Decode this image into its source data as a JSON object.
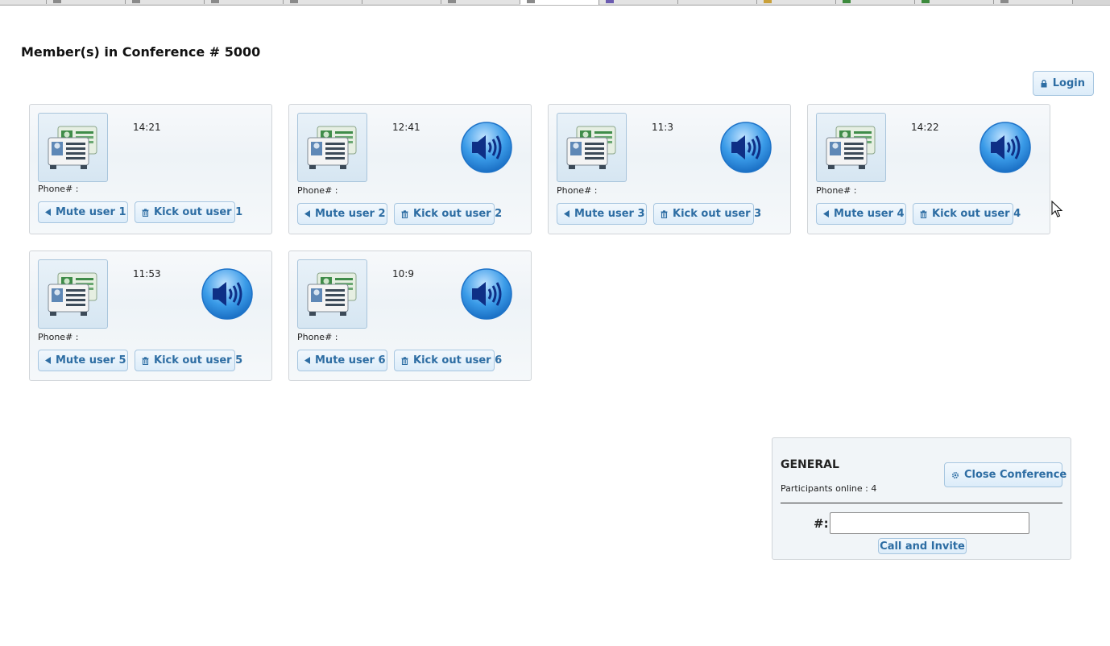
{
  "page": {
    "title": "Member(s) in Conference # 5000",
    "login_label": "Login"
  },
  "members": [
    {
      "time": "14:21",
      "phone_label": "Phone# :",
      "mute_label": "Mute user 1",
      "kick_label": "Kick out user 1",
      "speaking": false
    },
    {
      "time": "12:41",
      "phone_label": "Phone# :",
      "mute_label": "Mute user 2",
      "kick_label": "Kick out user 2",
      "speaking": true
    },
    {
      "time": "11:3",
      "phone_label": "Phone# :",
      "mute_label": "Mute user 3",
      "kick_label": "Kick out user 3",
      "speaking": true
    },
    {
      "time": "14:22",
      "phone_label": "Phone# :",
      "mute_label": "Mute user 4",
      "kick_label": "Kick out user 4",
      "speaking": true
    },
    {
      "time": "11:53",
      "phone_label": "Phone# :",
      "mute_label": "Mute user 5",
      "kick_label": "Kick out user 5",
      "speaking": true
    },
    {
      "time": "10:9",
      "phone_label": "Phone# :",
      "mute_label": "Mute user 6",
      "kick_label": "Kick out user 6",
      "speaking": true
    }
  ],
  "general": {
    "title": "GENERAL",
    "participants_online": "Participants online : 4",
    "close_label": "Close Conference",
    "number_label": "#:",
    "number_value": "",
    "call_label": "Call and Invite"
  },
  "icons": {
    "login": "lock-icon",
    "mute": "triangle-left-icon",
    "kick": "trash-icon",
    "close": "gear-icon",
    "avatar": "contact-card-icon",
    "speaker": "speaker-icon"
  },
  "colors": {
    "button_text": "#2d6da3",
    "button_border": "#a7c6e0",
    "speaker_blue": "#3a9be8"
  }
}
